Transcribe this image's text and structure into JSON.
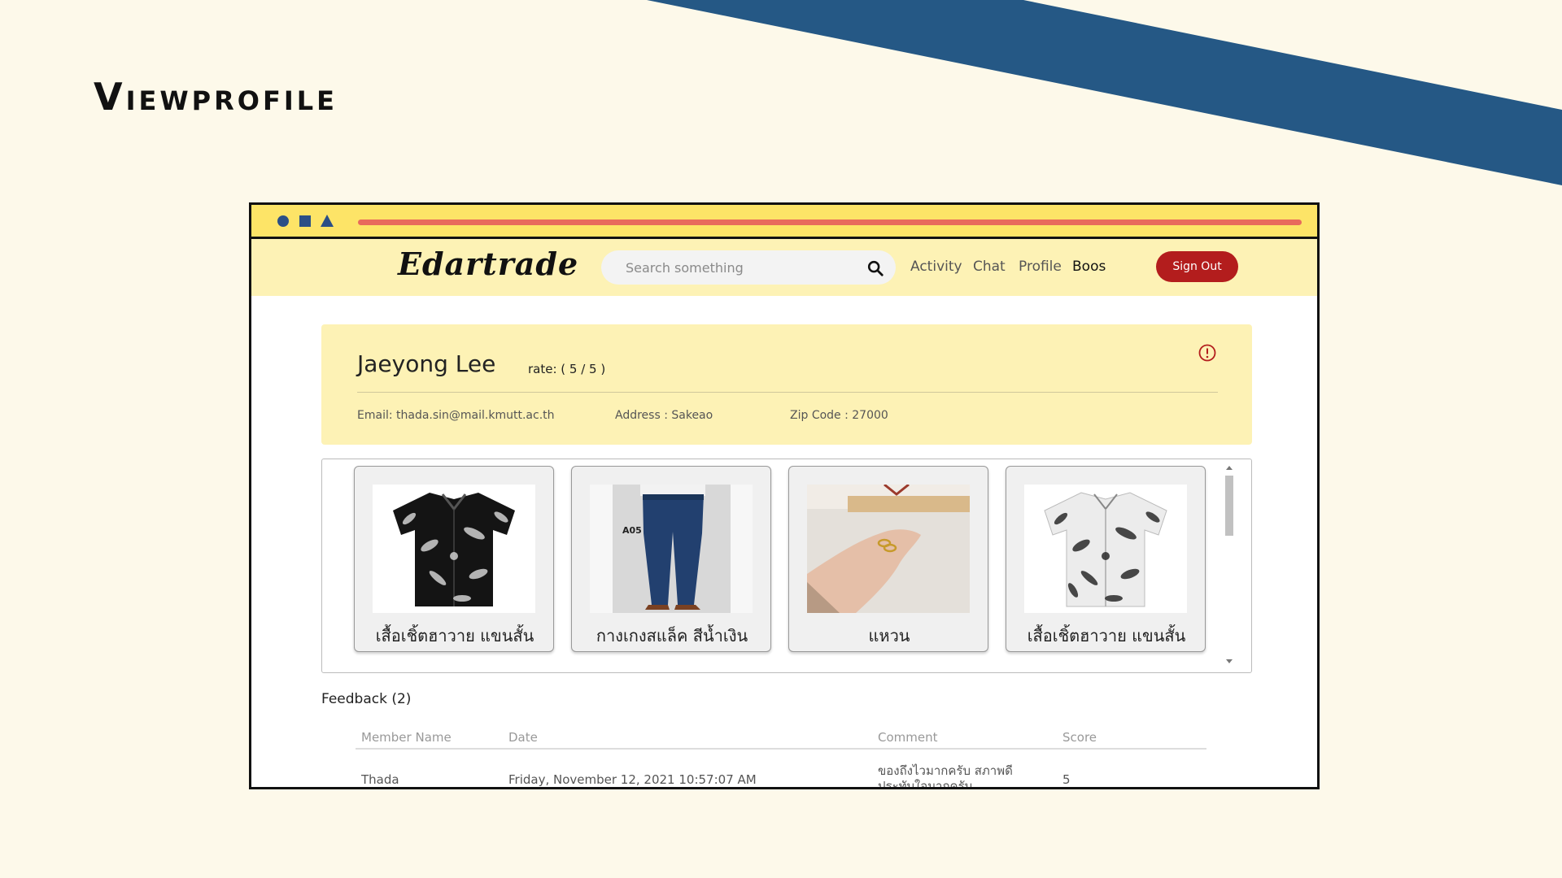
{
  "slide": {
    "title": "Viewprofile"
  },
  "colors": {
    "stripe": "#255885",
    "background": "#fdf9ea",
    "titlebar": "#fde467",
    "navbar": "#fdf2b5",
    "signout": "#b31d1d",
    "progress": "#e86a5c"
  },
  "navbar": {
    "logo": "Edartrade",
    "search_placeholder": "Search something",
    "links": [
      "Activity",
      "Chat",
      "Profile"
    ],
    "user": "Boos",
    "signout_label": "Sign Out"
  },
  "profile": {
    "name": "Jaeyong Lee",
    "rate": "rate: ( 5 / 5 )",
    "email": "Email: thada.sin@mail.kmutt.ac.th",
    "address": "Address : Sakeao",
    "zip": "Zip Code : 27000"
  },
  "products": [
    {
      "name": "เสื้อเชิ้ตฮาวาย แขนสั้น",
      "image": "black-hawaiian-shirt"
    },
    {
      "name": "กางเกงสแล็ค สีน้ำเงิน",
      "image": "navy-slacks"
    },
    {
      "name": "แหวน",
      "image": "gold-ring"
    },
    {
      "name": "เสื้อเชิ้ตฮาวาย แขนสั้น",
      "image": "white-hawaiian-shirt"
    }
  ],
  "feedback": {
    "title": "Feedback (2)",
    "columns": [
      "Member Name",
      "Date",
      "Comment",
      "Score"
    ],
    "rows": [
      {
        "member": "Thada",
        "date": "Friday, November 12, 2021 10:57:07 AM",
        "comment": "ของถึงไวมากครับ สภาพดี ประทับใจมากครับ",
        "score": "5"
      }
    ]
  }
}
